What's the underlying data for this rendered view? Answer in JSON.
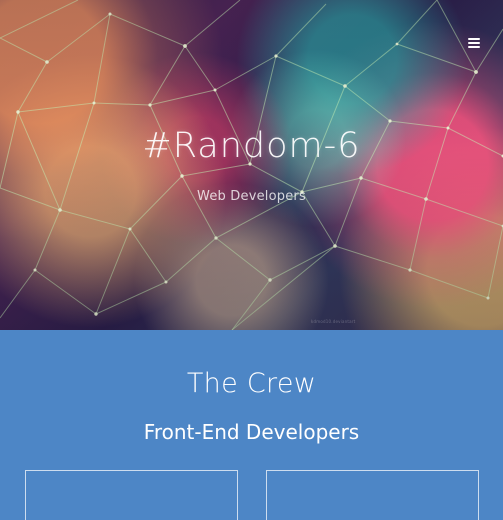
{
  "hero": {
    "title": "#Random-6",
    "subtitle": "Web Developers",
    "caption": "kdmod10.deviantart",
    "menu_icon": "hamburger-menu-icon"
  },
  "crew": {
    "heading": "The Crew",
    "subheading": "Front-End Developers",
    "cards": [
      {
        "avatar_icon": "developer-avatar"
      },
      {
        "avatar_icon": "developer-avatar"
      }
    ]
  },
  "colors": {
    "section_background": "#4d86c6",
    "text": "#ffffff"
  }
}
